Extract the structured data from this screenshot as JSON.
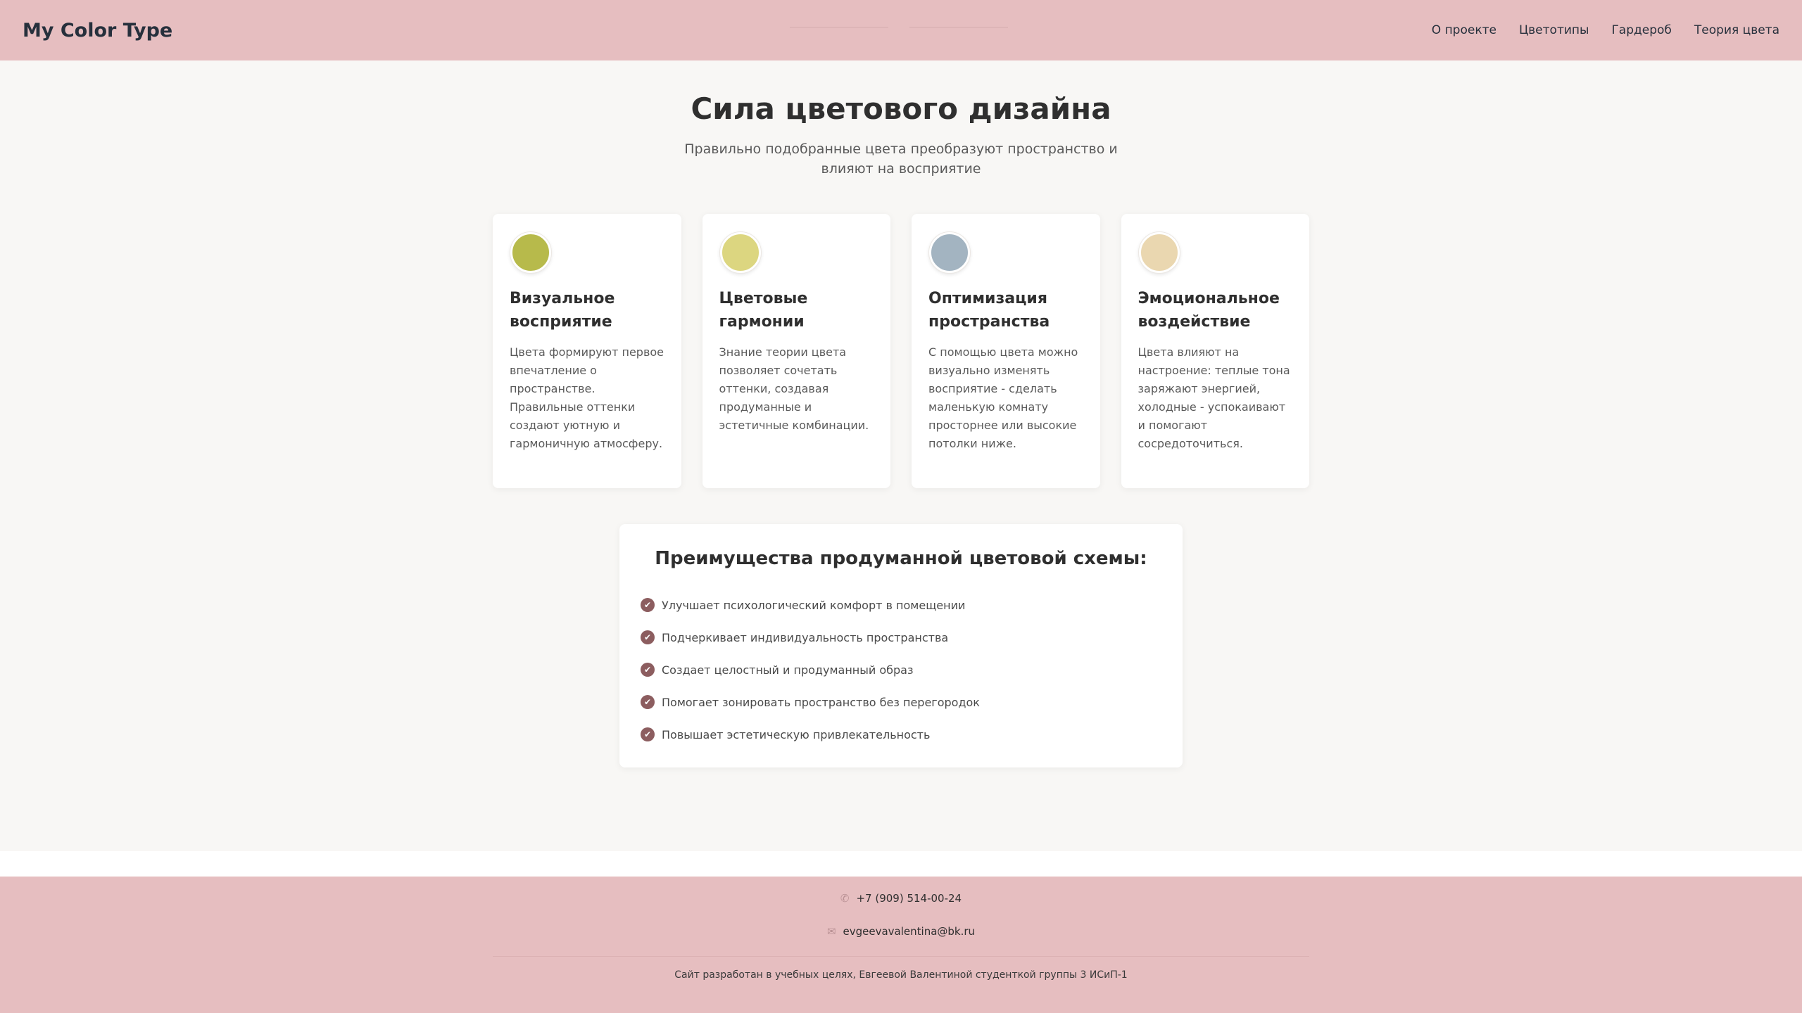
{
  "header": {
    "logo": "My Color Type",
    "nav": [
      "О проекте",
      "Цветотипы",
      "Гардероб",
      "Теория цвета"
    ]
  },
  "hero": {
    "title": "Сила цветового дизайна",
    "subtitle": "Правильно подобранные цвета преобразуют пространство и влияют на восприятие"
  },
  "cards": [
    {
      "color": "#b7ba4b",
      "title": "Визуальное восприятие",
      "text": "Цвета формируют первое впечатление о пространстве. Правильные оттенки создают уютную и гармоничную атмосферу."
    },
    {
      "color": "#dcd680",
      "title": "Цветовые гармонии",
      "text": "Знание теории цвета позволяет сочетать оттенки, создавая продуманные и эстетичные комбинации."
    },
    {
      "color": "#a3b4c1",
      "title": "Оптимизация пространства",
      "text": "С помощью цвета можно визуально изменять восприятие - сделать маленькую комнату просторнее или высокие потолки ниже."
    },
    {
      "color": "#ead7b0",
      "title": "Эмоциональное воздействие",
      "text": "Цвета влияют на настроение: теплые тона заряжают энергией, холодные - успокаивают и помогают сосредоточиться."
    }
  ],
  "benefits": {
    "title": "Преимущества продуманной цветовой схемы:",
    "items": [
      "Улучшает психологический комфорт в помещении",
      "Подчеркивает индивидуальность пространства",
      "Создает целостный и продуманный образ",
      "Помогает зонировать пространство без перегородок",
      "Повышает эстетическую привлекательность"
    ]
  },
  "footer": {
    "phone": "+7 (909) 514-00-24",
    "email": "evgeevavalentina@bk.ru",
    "copyright": "Сайт разработан в учебных целях, Евгеевой Валентиной студенткой группы 3 ИСиП-1"
  },
  "colors": {
    "header_bg": "#e6bec0",
    "page_bg": "#f8f7f5",
    "accent": "#8c5d5f"
  }
}
